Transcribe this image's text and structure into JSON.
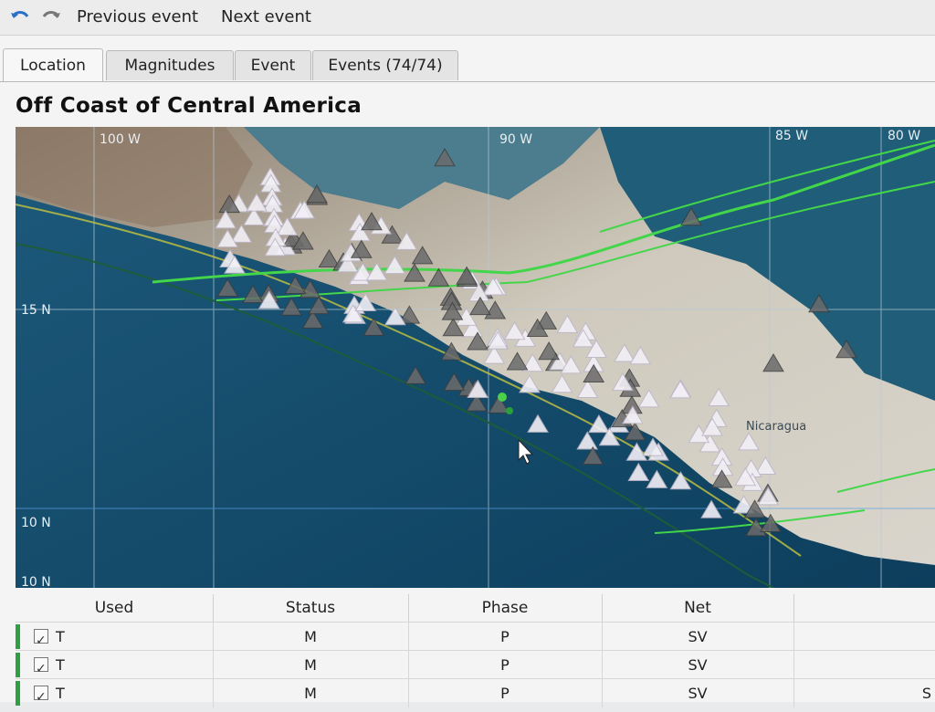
{
  "toolbar": {
    "back_icon": "back-arrow-icon",
    "forward_icon": "forward-arrow-icon",
    "previous_label": "Previous event",
    "next_label": "Next event"
  },
  "tabs": [
    {
      "label": "Location",
      "active": true
    },
    {
      "label": "Magnitudes",
      "active": false
    },
    {
      "label": "Event",
      "active": false
    },
    {
      "label": "Events (74/74)",
      "active": false
    }
  ],
  "region_title": "Off Coast of Central America",
  "map": {
    "longitude_labels": [
      "100 W",
      "90 W",
      "85 W",
      "80 W"
    ],
    "latitude_labels": [
      "15 N",
      "10 N",
      "10 N"
    ],
    "place_label": "Nicaragua",
    "colors": {
      "ocean": "#0f4766",
      "land": "#cfcabd",
      "fault": "#43d64a",
      "station": "#6b6b6b",
      "station_active": "#f2f0f6"
    }
  },
  "table": {
    "headers": [
      "Used",
      "Status",
      "Phase",
      "Net"
    ],
    "rows": [
      {
        "used": "T",
        "status": "M",
        "phase": "P",
        "net": "SV"
      },
      {
        "used": "T",
        "status": "M",
        "phase": "P",
        "net": "SV"
      },
      {
        "used": "T",
        "status": "M",
        "phase": "P",
        "net": "SV"
      }
    ],
    "partial_cell": "S"
  }
}
